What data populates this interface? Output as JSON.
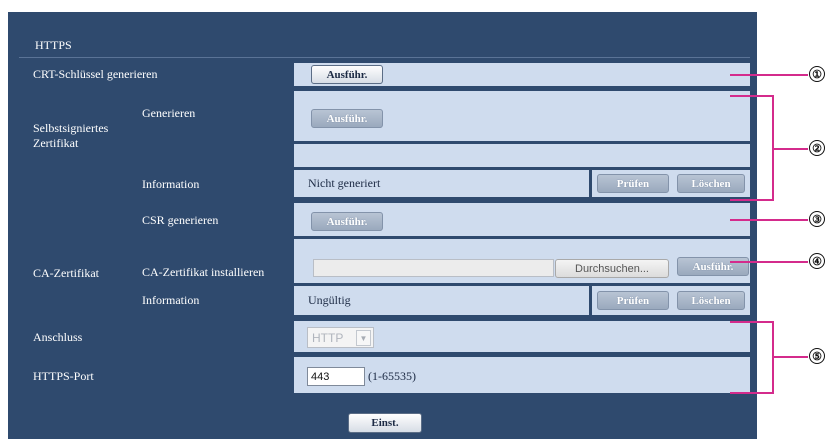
{
  "header": {
    "title": "HTTPS"
  },
  "rows": {
    "crt": {
      "label": "CRT-Schlüssel generieren",
      "button": "Ausführ."
    },
    "self_signed": {
      "group_label_line1": "Selbstsigniertes",
      "group_label_line2": "Zertifikat",
      "generate_label": "Generieren",
      "generate_button": "Ausführ.",
      "info_label": "Information",
      "info_value": "Nicht generiert",
      "check_button": "Prüfen",
      "delete_button": "Löschen"
    },
    "ca": {
      "group_label": "CA-Zertifikat",
      "csr_label": "CSR generieren",
      "csr_button": "Ausführ.",
      "install_label": "CA-Zertifikat installieren",
      "browse_button": "Durchsuchen...",
      "execute_button": "Ausführ.",
      "info_label": "Information",
      "info_value": "Ungültig",
      "check_button": "Prüfen",
      "delete_button": "Löschen"
    },
    "port_type": {
      "label": "Anschluss",
      "selected": "HTTP"
    },
    "https_port": {
      "label": "HTTPS-Port",
      "value": "443",
      "range": "(1-65535)"
    }
  },
  "footer": {
    "set_button": "Einst."
  },
  "callouts": [
    "①",
    "②",
    "③",
    "④",
    "⑤"
  ],
  "colors": {
    "panel": "#2f4a6e",
    "value_cell": "#cfdcee",
    "callout_line": "#d42b8c"
  }
}
